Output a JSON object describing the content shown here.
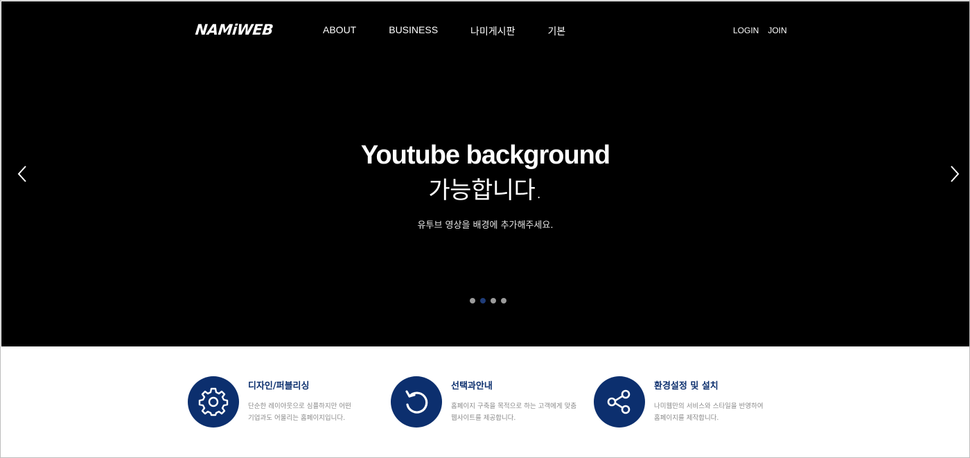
{
  "header": {
    "logo": "NAMiWEB",
    "nav": [
      "ABOUT",
      "BUSINESS",
      "나미게시판",
      "기본"
    ],
    "util": {
      "login": "LOGIN",
      "join": "JOIN"
    }
  },
  "hero": {
    "headline": "Youtube background",
    "headline_sub": "가능합니다.",
    "description": "유투브 영상을 배경에 추가해주세요.",
    "slide_count": 4,
    "active_slide": 2
  },
  "features": [
    {
      "icon": "gear-icon",
      "title": "디자인/퍼블리싱",
      "desc_line1": "단순한 레이아웃으로 심플하지만 어떤",
      "desc_line2": "기업과도 어울리는 홈페이지입니다."
    },
    {
      "icon": "refresh-icon",
      "title": "선택과안내",
      "desc_line1": "홈페이지 구축을 목적으로 하는 고객에게 맞춤",
      "desc_line2": "웹사이트를 제공합니다."
    },
    {
      "icon": "share-icon",
      "title": "환경설정 및 설치",
      "desc_line1": "나미웹만의 서비스와 스타일을 반영하여",
      "desc_line2": "홈페이지를 제작합니다."
    }
  ],
  "colors": {
    "hero_bg": "#000000",
    "accent": "#0c2f6e",
    "dot_inactive": "#9b9b9b",
    "dot_active": "#1f3c78"
  }
}
